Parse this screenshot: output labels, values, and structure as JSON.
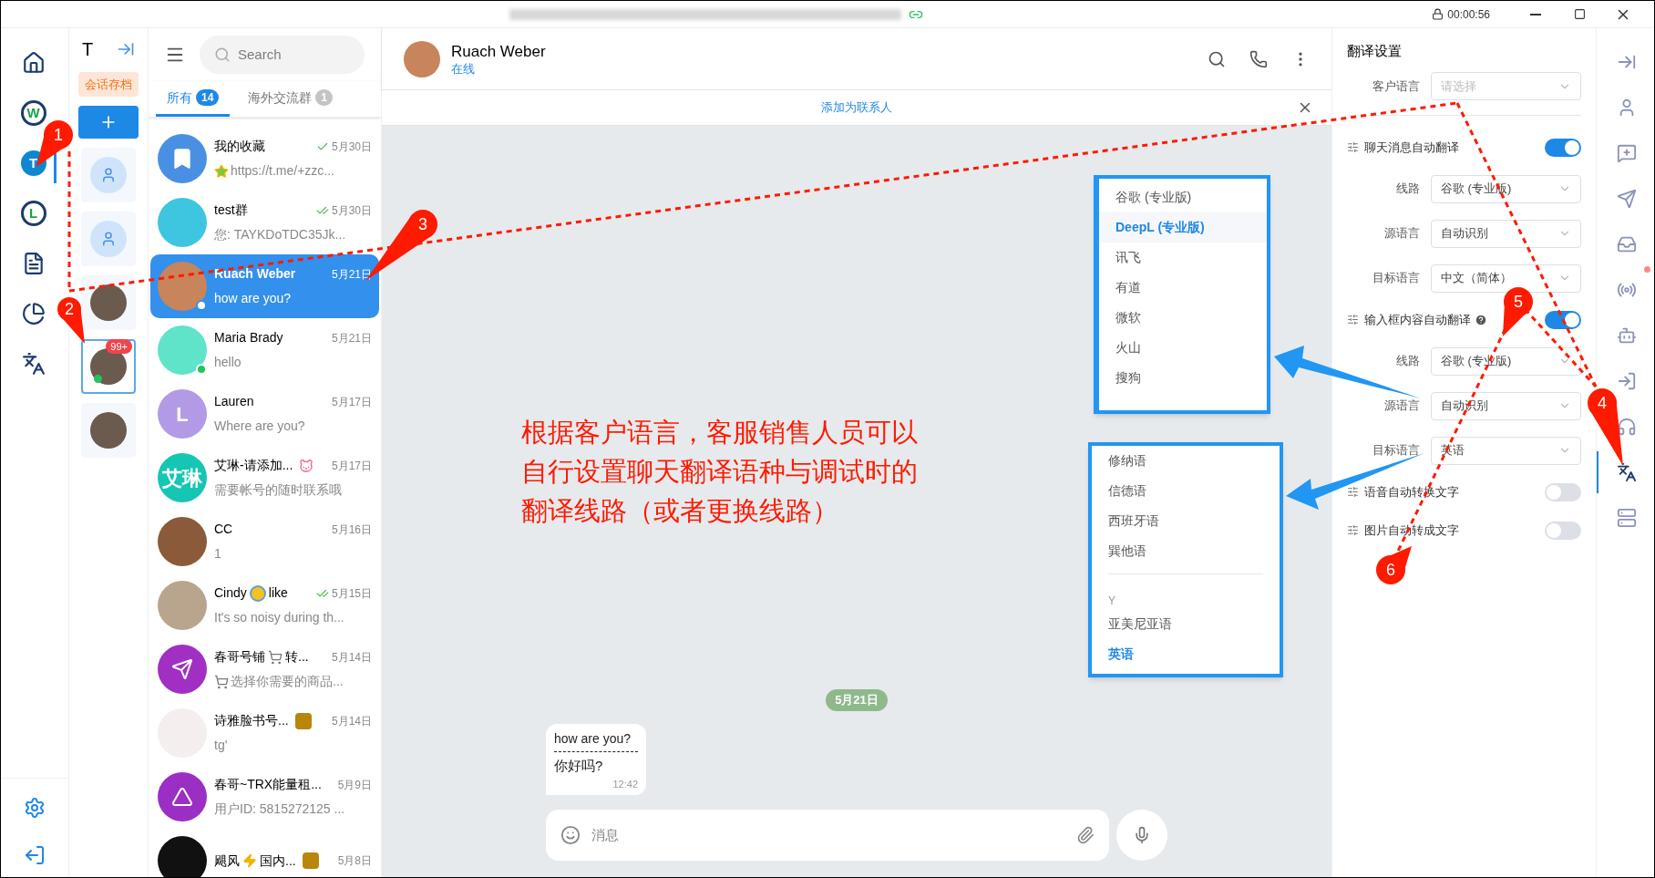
{
  "title_bar": {
    "timer": "00:00:56"
  },
  "rail": {
    "items": [
      {
        "kind": "home",
        "selected": false
      },
      {
        "kind": "ring-letter",
        "letter": "W",
        "selected": false
      },
      {
        "kind": "filled-letter",
        "letter": "T",
        "selected": true
      },
      {
        "kind": "ring-letter",
        "letter": "L",
        "selected": false
      },
      {
        "kind": "document",
        "selected": false
      },
      {
        "kind": "chart",
        "selected": false
      },
      {
        "kind": "translate",
        "selected": false
      }
    ]
  },
  "accounts": {
    "title": "T",
    "archive_label": "会话存档",
    "cards": [
      {
        "kind": "placeholder",
        "selected": false,
        "online": false
      },
      {
        "kind": "placeholder",
        "selected": false,
        "online": false
      },
      {
        "kind": "photo",
        "selected": false,
        "online": false
      },
      {
        "kind": "photo",
        "selected": true,
        "online": true,
        "badge": "99+"
      },
      {
        "kind": "photo",
        "selected": false,
        "online": false
      }
    ]
  },
  "chat_list": {
    "search_placeholder": "Search",
    "tabs": [
      {
        "label": "所有",
        "count": "14",
        "selected": true
      },
      {
        "label": "海外交流群",
        "count": "1",
        "selected": false
      }
    ],
    "chats": [
      {
        "name_parts": [
          {
            "kind": "text",
            "text": "我的收藏"
          }
        ],
        "receipt": {
          "kind": "sent"
        },
        "time": "5月30日",
        "preview_parts": [
          {
            "kind": "star-emoji"
          },
          {
            "kind": "text",
            "text": "https://t.me/+zzc..."
          }
        ],
        "avatar": {
          "kind": "bookmark",
          "color": "#4a90e2"
        },
        "online": false,
        "selected": false
      },
      {
        "name_parts": [
          {
            "kind": "text",
            "text": "test群"
          }
        ],
        "receipt": {
          "kind": "read"
        },
        "time": "5月30日",
        "preview_parts": [
          {
            "kind": "text",
            "text": "您: TAYKDoTDC35Jk..."
          }
        ],
        "avatar": {
          "kind": "photo",
          "color": "#3ec6e0"
        },
        "online": false,
        "selected": false
      },
      {
        "name_parts": [
          {
            "kind": "text",
            "text": "Ruach Weber"
          }
        ],
        "time": "5月21日",
        "preview_parts": [
          {
            "kind": "text",
            "text": "how are you?"
          }
        ],
        "avatar": {
          "kind": "photo",
          "color": "#c8845a"
        },
        "online": true,
        "selected": true
      },
      {
        "name_parts": [
          {
            "kind": "text",
            "text": "Maria Brady"
          }
        ],
        "time": "5月21日",
        "preview_parts": [
          {
            "kind": "text",
            "text": "hello"
          }
        ],
        "avatar": {
          "kind": "photo",
          "color": "#5fe3c9"
        },
        "online": true,
        "selected": false
      },
      {
        "name_parts": [
          {
            "kind": "text",
            "text": "Lauren"
          }
        ],
        "time": "5月17日",
        "preview_parts": [
          {
            "kind": "text",
            "text": "Where are you?"
          }
        ],
        "avatar": {
          "kind": "letter",
          "initial": "L",
          "color": "#b39ae6"
        },
        "online": false,
        "selected": false
      },
      {
        "name_parts": [
          {
            "kind": "text",
            "text": "艾琳-请添加..."
          }
        ],
        "tag": {
          "kind": "cat"
        },
        "time": "5月17日",
        "preview_parts": [
          {
            "kind": "text",
            "text": "需要帐号的随时联系哦"
          }
        ],
        "avatar": {
          "kind": "letter",
          "initial": "艾琳",
          "color": "#16c6b4"
        },
        "online": false,
        "selected": false
      },
      {
        "name_parts": [
          {
            "kind": "text",
            "text": "CC"
          }
        ],
        "time": "5月16日",
        "preview_parts": [
          {
            "kind": "text",
            "text": "1"
          }
        ],
        "avatar": {
          "kind": "photo",
          "color": "#8a5a3a"
        },
        "online": false,
        "selected": false
      },
      {
        "name_parts": [
          {
            "kind": "text",
            "text": "Cindy"
          },
          {
            "kind": "scream-emoji"
          },
          {
            "kind": "text",
            "text": "like"
          }
        ],
        "receipt": {
          "kind": "read"
        },
        "time": "5月15日",
        "preview_parts": [
          {
            "kind": "text",
            "text": "It's so noisy during th..."
          }
        ],
        "avatar": {
          "kind": "photo",
          "color": "#b9a58e"
        },
        "online": false,
        "selected": false
      },
      {
        "name_parts": [
          {
            "kind": "text",
            "text": "春哥号铺"
          },
          {
            "kind": "cart-emoji"
          },
          {
            "kind": "text",
            "text": "转..."
          }
        ],
        "time": "5月14日",
        "preview_parts": [
          {
            "kind": "cart-emoji"
          },
          {
            "kind": "text",
            "text": "选择你需要的商品..."
          }
        ],
        "avatar": {
          "kind": "plane",
          "color": "#a12fc4"
        },
        "online": false,
        "selected": false
      },
      {
        "name_parts": [
          {
            "kind": "text",
            "text": "诗雅脸书号..."
          }
        ],
        "tag": {
          "kind": "sticker"
        },
        "time": "5月14日",
        "preview_parts": [
          {
            "kind": "text",
            "text": "tg'"
          }
        ],
        "avatar": {
          "kind": "photo",
          "color": "#f4eeee"
        },
        "online": false,
        "selected": false
      },
      {
        "name_parts": [
          {
            "kind": "text",
            "text": "春哥~TRX能量租..."
          }
        ],
        "time": "5月9日",
        "preview_parts": [
          {
            "kind": "text",
            "text": "用户ID: 5815272125 ..."
          }
        ],
        "avatar": {
          "kind": "triangle",
          "color": "#9b2fc4"
        },
        "online": false,
        "selected": false
      },
      {
        "name_parts": [
          {
            "kind": "text",
            "text": "飓风"
          },
          {
            "kind": "bolt-emoji"
          },
          {
            "kind": "text",
            "text": "国内..."
          }
        ],
        "tag": {
          "kind": "sticker"
        },
        "time": "5月8日",
        "avatar": {
          "kind": "photo",
          "color": "#111111"
        },
        "online": false,
        "selected": false
      }
    ]
  },
  "chat": {
    "name": "Ruach Weber",
    "status": "在线",
    "add_contact": "添加为联系人",
    "date": "5月21日",
    "messages": [
      {
        "text": "how are you?",
        "translation": "你好吗?",
        "time": "12:42"
      }
    ],
    "input_placeholder": "消息"
  },
  "settings": {
    "title": "翻译设置",
    "customer_language": {
      "label": "客户语言",
      "placeholder": "请选择"
    },
    "rows": [
      {
        "kind": "toggle",
        "label": "聊天消息自动翻译",
        "on": true,
        "help": false
      },
      {
        "kind": "select",
        "label": "线路",
        "value": "谷歌 (专业版)"
      },
      {
        "kind": "select",
        "label": "源语言",
        "value": "自动识别"
      },
      {
        "kind": "select",
        "label": "目标语言",
        "value": "中文（简体）"
      },
      {
        "kind": "toggle",
        "label": "输入框内容自动翻译",
        "on": true,
        "help": true
      },
      {
        "kind": "select",
        "label": "线路",
        "value": "谷歌 (专业版)"
      },
      {
        "kind": "select",
        "label": "源语言",
        "value": "自动识别"
      },
      {
        "kind": "select",
        "label": "目标语言",
        "value": "英语"
      },
      {
        "kind": "toggle",
        "label": "语音自动转换文字",
        "on": false,
        "help": false
      },
      {
        "kind": "toggle",
        "label": "图片自动转成文字",
        "on": false,
        "help": false
      }
    ]
  },
  "route_menu": {
    "items": [
      {
        "label": "谷歌 (专业版)",
        "selected": false
      },
      {
        "label": "DeepL (专业版)",
        "selected": true
      },
      {
        "label": "讯飞",
        "selected": false
      },
      {
        "label": "有道",
        "selected": false
      },
      {
        "label": "微软",
        "selected": false
      },
      {
        "label": "火山",
        "selected": false
      },
      {
        "label": "搜狗",
        "selected": false
      }
    ]
  },
  "language_menu": {
    "items": [
      {
        "kind": "option",
        "label": "修纳语",
        "selected": false
      },
      {
        "kind": "option",
        "label": "信德语",
        "selected": false
      },
      {
        "kind": "option",
        "label": "西班牙语",
        "selected": false
      },
      {
        "kind": "option",
        "label": "巽他语",
        "selected": false
      },
      {
        "kind": "divider"
      },
      {
        "kind": "group",
        "label": "Y"
      },
      {
        "kind": "option",
        "label": "亚美尼亚语",
        "selected": false
      },
      {
        "kind": "option",
        "label": "英语",
        "selected": true
      }
    ]
  },
  "right_rail": {
    "items": [
      {
        "kind": "collapse",
        "selected": false,
        "alert": false
      },
      {
        "kind": "person",
        "selected": false,
        "alert": false
      },
      {
        "kind": "chat-plus",
        "selected": false,
        "alert": false
      },
      {
        "kind": "send",
        "selected": false,
        "alert": false
      },
      {
        "kind": "inbox",
        "selected": false,
        "alert": true
      },
      {
        "kind": "antenna",
        "selected": false,
        "alert": false
      },
      {
        "kind": "robot",
        "selected": false,
        "alert": false
      },
      {
        "kind": "login",
        "selected": false,
        "alert": false
      },
      {
        "kind": "headset",
        "selected": false,
        "alert": false
      },
      {
        "kind": "translate",
        "selected": true,
        "alert": false
      },
      {
        "kind": "server",
        "selected": false,
        "alert": false
      }
    ]
  },
  "annotations": {
    "markers": [
      "1",
      "2",
      "3",
      "4",
      "5",
      "6"
    ],
    "note_lines": [
      "根据客户语言，客服销售人员可以",
      "自行设置聊天翻译语种与调试时的",
      "翻译线路（或者更换线路）"
    ]
  }
}
